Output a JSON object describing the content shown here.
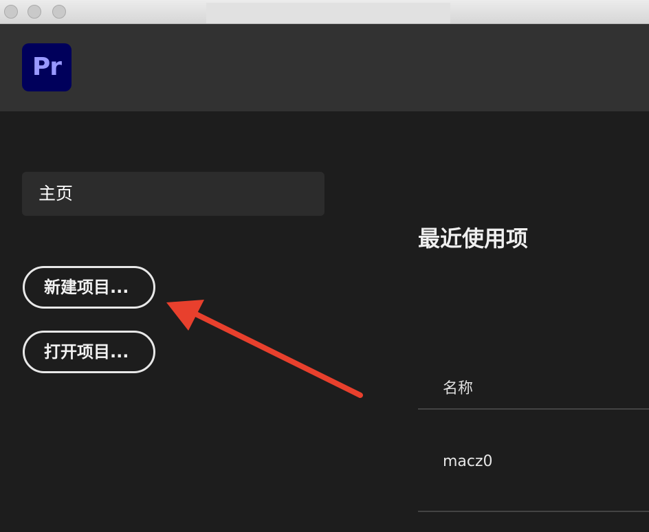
{
  "app": {
    "logo_text": "Pr",
    "logo_bg": "#00005b",
    "logo_fg": "#9999ff"
  },
  "nav": {
    "home_label": "主页"
  },
  "actions": {
    "new_project_label": "新建项目...",
    "open_project_label": "打开项目..."
  },
  "recent": {
    "title": "最近使用项",
    "column_name_header": "名称",
    "rows": [
      {
        "name": "macz0"
      }
    ]
  },
  "annotation": {
    "arrow_color": "#e8402d",
    "target": "new-project-button"
  }
}
